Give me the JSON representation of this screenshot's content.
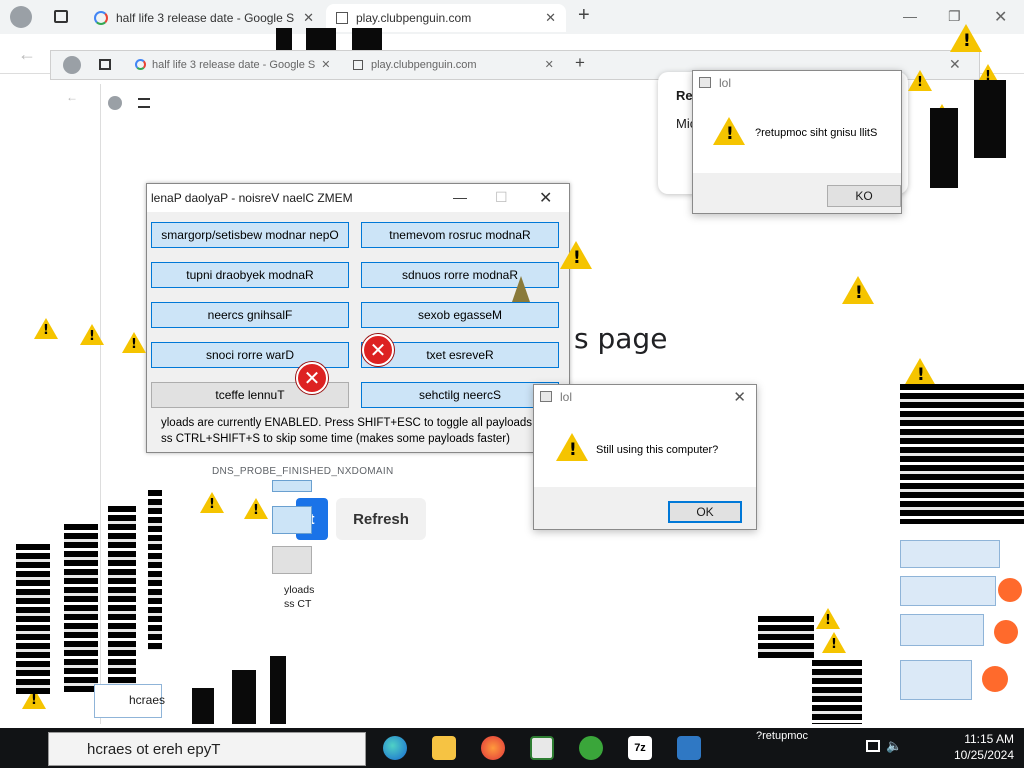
{
  "browser": {
    "tabs": [
      {
        "label": "half life 3 release date - Google S"
      },
      {
        "label": "play.clubpenguin.com"
      }
    ],
    "ghost_tabs": [
      {
        "label": "half life 3 release date - Google S"
      },
      {
        "label": "play.clubpenguin.com"
      }
    ]
  },
  "error_page": {
    "heading_fragment": "s page",
    "code": "DNS_PROBE_FINISHED_NXDOMAIN",
    "refresh_label": "Refresh",
    "blue_btn_fragment": "t"
  },
  "memz": {
    "title": "lenaP daolyaP - noisreV naelC ZMEM",
    "buttons": [
      {
        "label": "smargorp/setisbew modnar nepO",
        "enabled": true
      },
      {
        "label": "tnemevom rosruc modnaR",
        "enabled": true
      },
      {
        "label": "tupni draobyek modnaR",
        "enabled": true
      },
      {
        "label": "sdnuos rorre modnaR",
        "enabled": true
      },
      {
        "label": "neercs gnihsalF",
        "enabled": true
      },
      {
        "label": "sexob egasseM",
        "enabled": true
      },
      {
        "label": "snoci rorre warD",
        "enabled": true
      },
      {
        "label": "txet esreveR",
        "enabled": true
      },
      {
        "label": "tceffe lennuT",
        "enabled": false
      },
      {
        "label": "sehctilg neercS",
        "enabled": true
      }
    ],
    "note1": "yloads are currently ENABLED. Press SHIFT+ESC to toggle all payloads!",
    "note2": "ss CTRL+SHIFT+S to skip some time (makes some payloads faster)"
  },
  "dialog_main": {
    "title": "lol",
    "message": "Still using this computer?",
    "ok": "OK"
  },
  "dialog_reversed": {
    "title": "lol",
    "message": "?retupmoc siht gnisu llitS",
    "ok": "KO"
  },
  "background_fragments": {
    "rel": "Rel",
    "mic": "Mic",
    "payloads_frag1": "yloads",
    "payloads_frag2": "ss CT",
    "search_frag": "hcraes"
  },
  "taskbar": {
    "search_placeholder": "hcraes ot ereh epyT",
    "time": "11:15 AM",
    "date": "10/25/2024",
    "tray_fragment": "?retupmoc"
  },
  "colors": {
    "accent": "#0078d7",
    "memz_button": "#cce4f7",
    "warning": "#f5c400",
    "error": "#dd2222",
    "taskbar": "#111315"
  }
}
